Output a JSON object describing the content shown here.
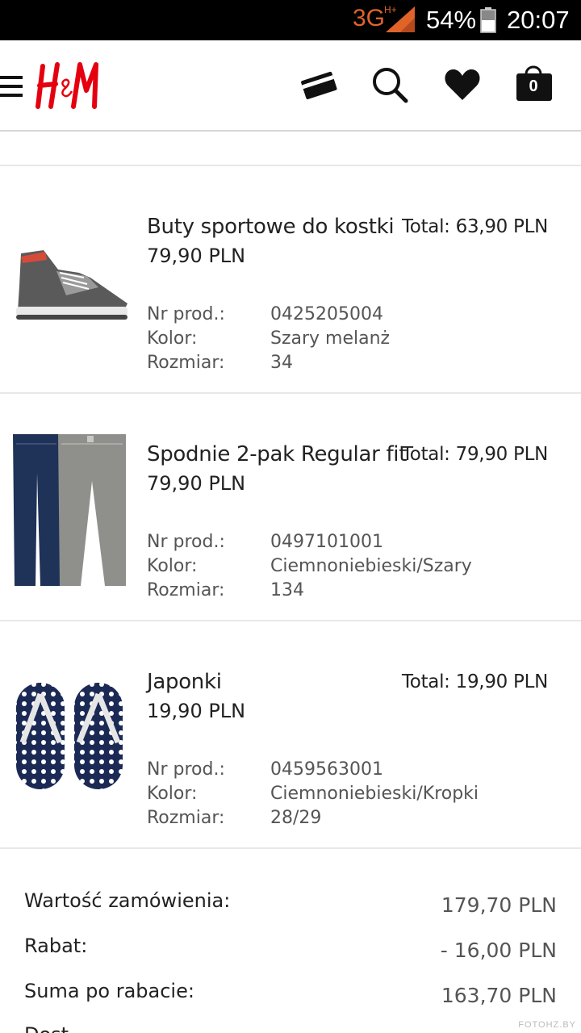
{
  "status_bar": {
    "network": "3G",
    "network_sub": "H+",
    "battery_percent": "54%",
    "time": "20:07"
  },
  "header": {
    "logo_text": "H&M",
    "bag_count": "0"
  },
  "products": [
    {
      "name": "Buty sportowe do kostki",
      "price": "79,90 PLN",
      "total": "Total: 63,90 PLN",
      "nr_label": "Nr prod.:",
      "nr_value": "0425205004",
      "color_label": "Kolor:",
      "color_value": "Szary melanż",
      "size_label": "Rozmiar:",
      "size_value": "34",
      "image_icon": "sneaker-image"
    },
    {
      "name": "Spodnie 2-pak Regular fit",
      "price": "79,90 PLN",
      "total": "Total: 79,90 PLN",
      "nr_label": "Nr prod.:",
      "nr_value": "0497101001",
      "color_label": "Kolor:",
      "color_value": "Ciemnoniebieski/Szary",
      "size_label": "Rozmiar:",
      "size_value": "134",
      "image_icon": "trousers-image"
    },
    {
      "name": "Japonki",
      "price": "19,90 PLN",
      "total": "Total: 19,90 PLN",
      "nr_label": "Nr prod.:",
      "nr_value": "0459563001",
      "color_label": "Kolor:",
      "color_value": "Ciemnoniebieski/Kropki",
      "size_label": "Rozmiar:",
      "size_value": "28/29",
      "image_icon": "flip-flops-image"
    }
  ],
  "summary": {
    "order_value_label": "Wartość zamówienia:",
    "order_value": "179,70 PLN",
    "discount_label": "Rabat:",
    "discount_value": "- 16,00 PLN",
    "after_discount_label": "Suma po rabacie:",
    "after_discount_value": "163,70 PLN",
    "next_label_partial": "Dost"
  },
  "watermark": "FOTOHZ.BY",
  "colors": {
    "brand_red": "#e50010",
    "network_orange": "#e0632a",
    "text_dark": "#222222",
    "text_grey": "#555555"
  }
}
